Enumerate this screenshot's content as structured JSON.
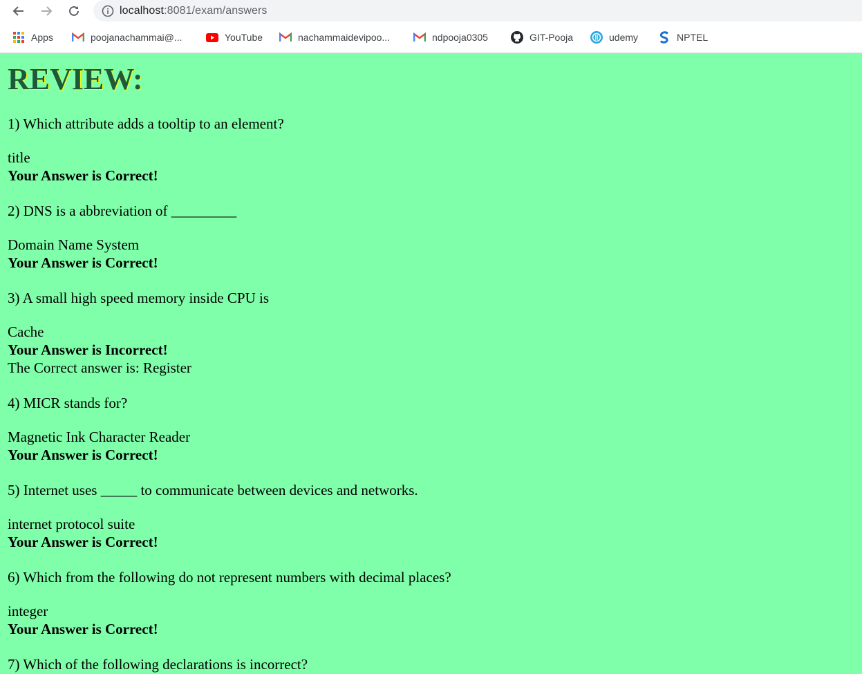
{
  "browser": {
    "url_host": "localhost",
    "url_path": ":8081/exam/answers",
    "bookmarks": [
      {
        "label": "Apps",
        "icon": "apps-grid-icon"
      },
      {
        "label": "poojanachammai@...",
        "icon": "gmail-icon"
      },
      {
        "label": "YouTube",
        "icon": "youtube-icon"
      },
      {
        "label": "nachammaidevipoo...",
        "icon": "gmail-icon"
      },
      {
        "label": "ndpooja0305",
        "icon": "gmail-icon"
      },
      {
        "label": "GIT-Pooja",
        "icon": "github-icon"
      },
      {
        "label": "udemy",
        "icon": "udemy-icon"
      },
      {
        "label": "NPTEL",
        "icon": "nptel-icon"
      }
    ]
  },
  "page": {
    "title": "REVIEW:",
    "items": [
      {
        "question": "1) Which attribute adds a tooltip to an element?",
        "answer": "title",
        "verdict": "Your Answer is Correct!",
        "correct": ""
      },
      {
        "question": "2) DNS is a abbreviation of _________",
        "answer": "Domain Name System",
        "verdict": "Your Answer is Correct!",
        "correct": ""
      },
      {
        "question": "3) A small high speed memory inside CPU is",
        "answer": "Cache",
        "verdict": "Your Answer is Incorrect!",
        "correct": "The Correct answer is: Register"
      },
      {
        "question": "4) MICR stands for?",
        "answer": "Magnetic Ink Character Reader",
        "verdict": "Your Answer is Correct!",
        "correct": ""
      },
      {
        "question": "5) Internet uses _____ to communicate between devices and networks.",
        "answer": "internet protocol suite",
        "verdict": "Your Answer is Correct!",
        "correct": ""
      },
      {
        "question": "6) Which from the following do not represent numbers with decimal places?",
        "answer": "integer",
        "verdict": "Your Answer is Correct!",
        "correct": ""
      },
      {
        "question": "7) Which of the following declarations is incorrect?",
        "answer": "",
        "verdict": "",
        "correct": ""
      }
    ]
  },
  "colors": {
    "page_background": "#80ffaa",
    "title": "#1e5a3a",
    "title_shadow": "#ffff00"
  }
}
